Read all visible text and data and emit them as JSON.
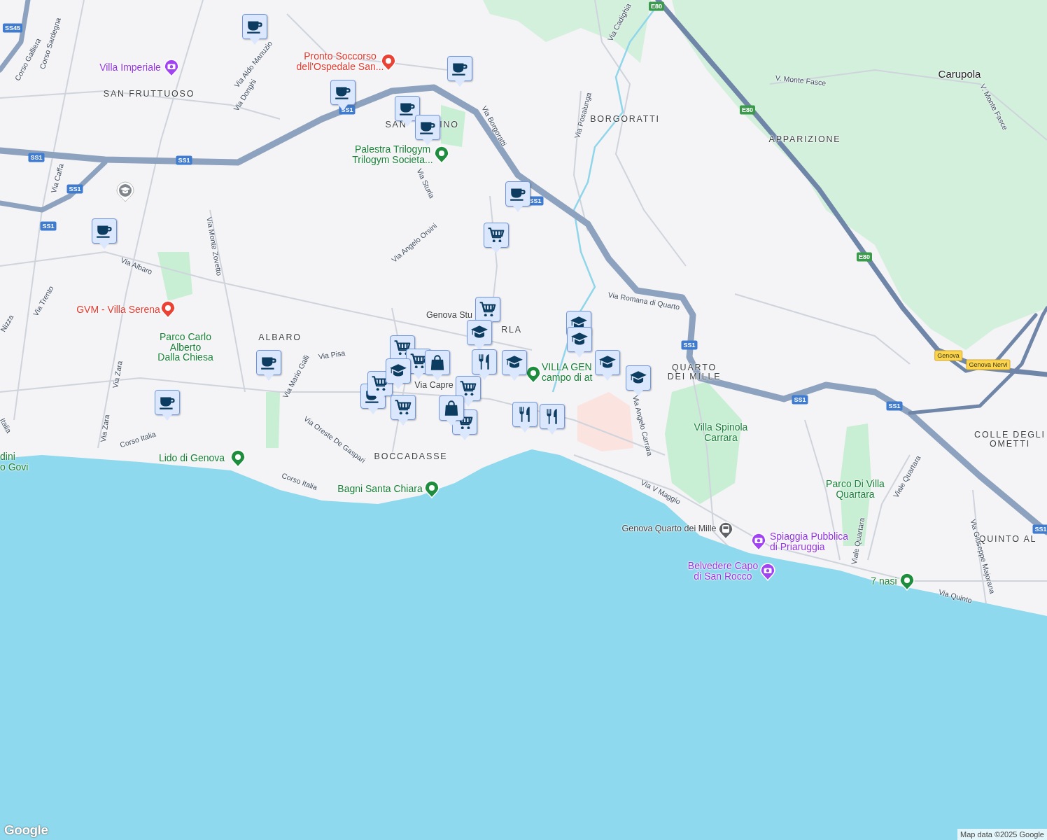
{
  "labels": [
    {
      "kind": "district",
      "lines": [
        "SAN FRUTTUOSO"
      ]
    },
    {
      "kind": "district",
      "lines": [
        "SAN"
      ]
    },
    {
      "kind": "district",
      "lines": [
        "INO"
      ]
    },
    {
      "kind": "district",
      "lines": [
        "BORGORATTI"
      ]
    },
    {
      "kind": "district",
      "lines": [
        "APPARIZIONE"
      ]
    },
    {
      "kind": "town",
      "lines": [
        "Carupola"
      ]
    },
    {
      "kind": "district",
      "lines": [
        "ALBARO"
      ]
    },
    {
      "kind": "district",
      "lines": [
        "RLA"
      ]
    },
    {
      "kind": "district",
      "lines": [
        "QUARTO",
        "DEI MILLE"
      ]
    },
    {
      "kind": "district",
      "lines": [
        "BOCCADASSE"
      ]
    },
    {
      "kind": "district",
      "lines": [
        "COLLE DEGLI",
        "OMETTI"
      ]
    },
    {
      "kind": "district",
      "lines": [
        "QUINTO AL"
      ]
    },
    {
      "kind": "street",
      "lines": [
        "Corso Galliera"
      ]
    },
    {
      "kind": "street",
      "lines": [
        "Corso Sardegna"
      ]
    },
    {
      "kind": "street",
      "lines": [
        "Via Aldo Manuzio"
      ]
    },
    {
      "kind": "street",
      "lines": [
        "Via Donghi"
      ]
    },
    {
      "kind": "street",
      "lines": [
        "Via Caffa"
      ]
    },
    {
      "kind": "street",
      "lines": [
        "Via Monte Zovetto"
      ]
    },
    {
      "kind": "street",
      "lines": [
        "Via Albaro"
      ]
    },
    {
      "kind": "street",
      "lines": [
        "Via Trento"
      ]
    },
    {
      "kind": "street",
      "lines": [
        "Via Zara"
      ]
    },
    {
      "kind": "street",
      "lines": [
        "Via Zara"
      ]
    },
    {
      "kind": "street",
      "lines": [
        "Corso Italia"
      ]
    },
    {
      "kind": "street",
      "lines": [
        "Via Mario Galli"
      ]
    },
    {
      "kind": "street",
      "lines": [
        "Via Pisa"
      ]
    },
    {
      "kind": "street",
      "lines": [
        "Via Oreste De Gaspari"
      ]
    },
    {
      "kind": "street",
      "lines": [
        "Corso Italia"
      ]
    },
    {
      "kind": "street",
      "lines": [
        "Via Borgoratti"
      ]
    },
    {
      "kind": "street",
      "lines": [
        "Via Sturla"
      ]
    },
    {
      "kind": "street",
      "lines": [
        "Via Angelo Orsini"
      ]
    },
    {
      "kind": "street",
      "lines": [
        "Via Posalunga"
      ]
    },
    {
      "kind": "street",
      "lines": [
        "Via Cadighia"
      ]
    },
    {
      "kind": "street",
      "lines": [
        "V. Monte Fasce"
      ]
    },
    {
      "kind": "street",
      "lines": [
        "V. Monte Fasce"
      ]
    },
    {
      "kind": "street",
      "lines": [
        "Via Romana di Quarto"
      ]
    },
    {
      "kind": "street",
      "lines": [
        "Via Angelo Carrara"
      ]
    },
    {
      "kind": "street",
      "lines": [
        "Via V Maggio"
      ]
    },
    {
      "kind": "street",
      "lines": [
        "Viale Quartara"
      ]
    },
    {
      "kind": "street",
      "lines": [
        "Viale Quartara"
      ]
    },
    {
      "kind": "street",
      "lines": [
        "Via Giuseppe Majorana"
      ]
    },
    {
      "kind": "street",
      "lines": [
        "Via Quinto"
      ]
    },
    {
      "kind": "transit",
      "lines": [
        "Genova Stu"
      ]
    },
    {
      "kind": "transit",
      "lines": [
        "Via Capre"
      ]
    },
    {
      "kind": "street",
      "lines": [
        "Nizza"
      ]
    },
    {
      "kind": "street",
      "lines": [
        "Italia"
      ]
    },
    {
      "kind": "attraction",
      "lines": [
        "Villa Imperiale"
      ],
      "pin": true
    },
    {
      "kind": "health",
      "lines": [
        "Pronto Soccorso",
        "dell'Ospedale San..."
      ],
      "pin": true
    },
    {
      "kind": "park",
      "lines": [
        "Palestra Trilogym",
        "Trilogym Societa..."
      ],
      "pin": true
    },
    {
      "kind": "health",
      "lines": [
        "GVM - Villa Serena"
      ],
      "pin": true
    },
    {
      "kind": "park",
      "lines": [
        "Parco Carlo",
        "Alberto",
        "Dalla Chiesa"
      ],
      "pin": false
    },
    {
      "kind": "park",
      "lines": [
        "Lido di Genova"
      ],
      "pin": true
    },
    {
      "kind": "park",
      "lines": [
        "Bagni Santa Chiara"
      ],
      "pin": true
    },
    {
      "kind": "park",
      "lines": [
        "VILLA GEN",
        "campo di at"
      ],
      "pin": true
    },
    {
      "kind": "park",
      "lines": [
        "dini",
        "o Govi"
      ],
      "pin": false
    },
    {
      "kind": "park",
      "lines": [
        "Villa Spinola",
        "Carrara"
      ],
      "pin": false
    },
    {
      "kind": "park",
      "lines": [
        "Parco Di Villa",
        "Quartara"
      ],
      "pin": false
    },
    {
      "kind": "transit",
      "lines": [
        "Genova Quarto dei Mille"
      ],
      "pin": true
    },
    {
      "kind": "attraction",
      "lines": [
        "Spiaggia Pubblica",
        "di Priaruggia"
      ],
      "pin": true
    },
    {
      "kind": "attraction",
      "lines": [
        "Belvedere Capo",
        "di San Rocco"
      ],
      "pin": true
    },
    {
      "kind": "park",
      "lines": [
        "7 nasi"
      ],
      "pin": true
    }
  ],
  "markers": [
    {
      "kind": "coffee"
    },
    {
      "kind": "coffee"
    },
    {
      "kind": "coffee"
    },
    {
      "kind": "coffee"
    },
    {
      "kind": "coffee"
    },
    {
      "kind": "coffee"
    },
    {
      "kind": "coffee"
    },
    {
      "kind": "coffee"
    },
    {
      "kind": "coffee"
    },
    {
      "kind": "coffee"
    },
    {
      "kind": "cart"
    },
    {
      "kind": "cart"
    },
    {
      "kind": "cart"
    },
    {
      "kind": "cart"
    },
    {
      "kind": "cart"
    },
    {
      "kind": "cart"
    },
    {
      "kind": "cart"
    },
    {
      "kind": "cart"
    },
    {
      "kind": "school"
    },
    {
      "kind": "school"
    },
    {
      "kind": "school"
    },
    {
      "kind": "school"
    },
    {
      "kind": "school"
    },
    {
      "kind": "school"
    },
    {
      "kind": "school"
    },
    {
      "kind": "restaurant"
    },
    {
      "kind": "restaurant"
    },
    {
      "kind": "restaurant"
    },
    {
      "kind": "bag"
    },
    {
      "kind": "bag"
    },
    {
      "kind": "school-pin"
    }
  ],
  "road_shields": [
    {
      "text": "SS45",
      "kind": "national"
    },
    {
      "text": "SS1",
      "kind": "national"
    },
    {
      "text": "SS1",
      "kind": "national"
    },
    {
      "text": "SS1",
      "kind": "national"
    },
    {
      "text": "SS1",
      "kind": "national"
    },
    {
      "text": "SS1",
      "kind": "national"
    },
    {
      "text": "SS1",
      "kind": "national"
    },
    {
      "text": "SS1",
      "kind": "national"
    },
    {
      "text": "SS1",
      "kind": "national"
    },
    {
      "text": "SS1",
      "kind": "national"
    },
    {
      "text": "SS1",
      "kind": "national"
    },
    {
      "text": "E80",
      "kind": "european"
    },
    {
      "text": "E80",
      "kind": "european"
    },
    {
      "text": "E80",
      "kind": "european"
    },
    {
      "text": "Genova",
      "kind": "exit"
    },
    {
      "text": "Genova Nervi",
      "kind": "exit"
    }
  ],
  "logo": "Google",
  "attribution": "Map data ©2025 Google"
}
